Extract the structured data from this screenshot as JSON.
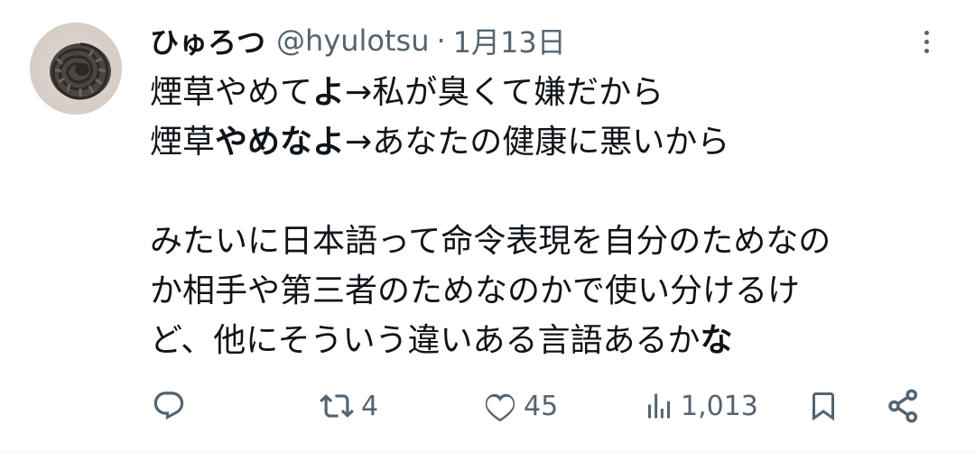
{
  "tweet": {
    "author": {
      "display_name": "ひゅろつ",
      "handle": "@hyulotsu",
      "avatar_icon": "ammonite-avatar"
    },
    "separator": "·",
    "date": "1月13日",
    "lines": [
      [
        {
          "text": "煙草やめて",
          "bold": false
        },
        {
          "text": "よ",
          "bold": true
        },
        {
          "text": "→私が臭くて嫌だから",
          "bold": false
        }
      ],
      [
        {
          "text": "煙草",
          "bold": false
        },
        {
          "text": "やめなよ",
          "bold": true
        },
        {
          "text": "→あなたの健康に悪いから",
          "bold": false
        }
      ],
      [],
      [
        {
          "text": "みたいに日本語って命令表現を自分のためなの",
          "bold": false
        }
      ],
      [
        {
          "text": "か相手や第三者のためなのかで使い分けるけ",
          "bold": false
        }
      ],
      [
        {
          "text": "ど、他にそういう違いある言語あるか",
          "bold": false
        },
        {
          "text": "な",
          "bold": true
        }
      ]
    ]
  },
  "actions": {
    "reply": {
      "icon": "reply-icon",
      "count": ""
    },
    "retweet": {
      "icon": "retweet-icon",
      "count": "4"
    },
    "like": {
      "icon": "heart-icon",
      "count": "45"
    },
    "views": {
      "icon": "views-icon",
      "count": "1,013"
    },
    "bookmark": {
      "icon": "bookmark-icon",
      "count": ""
    },
    "share": {
      "icon": "share-icon",
      "count": ""
    }
  },
  "colors": {
    "text_primary": "#0f1419",
    "text_secondary": "#536471",
    "divider": "#eff3f4"
  }
}
